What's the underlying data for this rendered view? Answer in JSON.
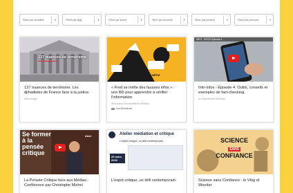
{
  "filters": [
    {
      "placeholder": "Filtrer par discipline"
    },
    {
      "placeholder": "Filtrer par tags"
    },
    {
      "placeholder": "Filtrer par soiree"
    },
    {
      "placeholder": "Filtrer par structure"
    },
    {
      "placeholder": "Filtrer par contenu"
    },
    {
      "placeholder": "Filtrer par parcours"
    }
  ],
  "cards": [
    {
      "title": "137 nuances de terrorisme. Les djihadistes de France face à la justice.",
      "tags": "#Sociologie",
      "thumb_text": "137 nuances de terrorisme"
    },
    {
      "title": "« Fred se méfie des fausses infos » : une BD pour apprendre à vérifier l'information.",
      "tags": "#Education  #Journalisme  #Médias",
      "meta": "Les Mondeurs",
      "thumb_text": "FRED SE MÉFIE"
    },
    {
      "title": "Info-Intox - Épisode 4. Outils, conseils et exemples de fact-checking.",
      "tags": "#Compétences  #Médias",
      "thumb_text": "INFO - INTOX Épisode 4"
    },
    {
      "title": "La Pensée Critique face aux Médias - Conférence par Christophe Michel",
      "thumb_text_1": "Se former",
      "thumb_text_2": "à la",
      "thumb_text_3": "pensée",
      "thumb_text_4": "critique",
      "thumb_badge": "dane"
    },
    {
      "title": "L'esprit critique, un défi contemporain.",
      "thumb_text_1": "Atelier médiation et critique",
      "thumb_text_2": "L'esprit critique, un défi contemporain",
      "thumb_badge": "20 mars 2020"
    },
    {
      "title": "Science sans Confiance - le Vlog of Wonder",
      "thumb_text_1": "SCIENCE",
      "thumb_text_2": "SANS",
      "thumb_text_3": "CONFIANCE"
    }
  ]
}
